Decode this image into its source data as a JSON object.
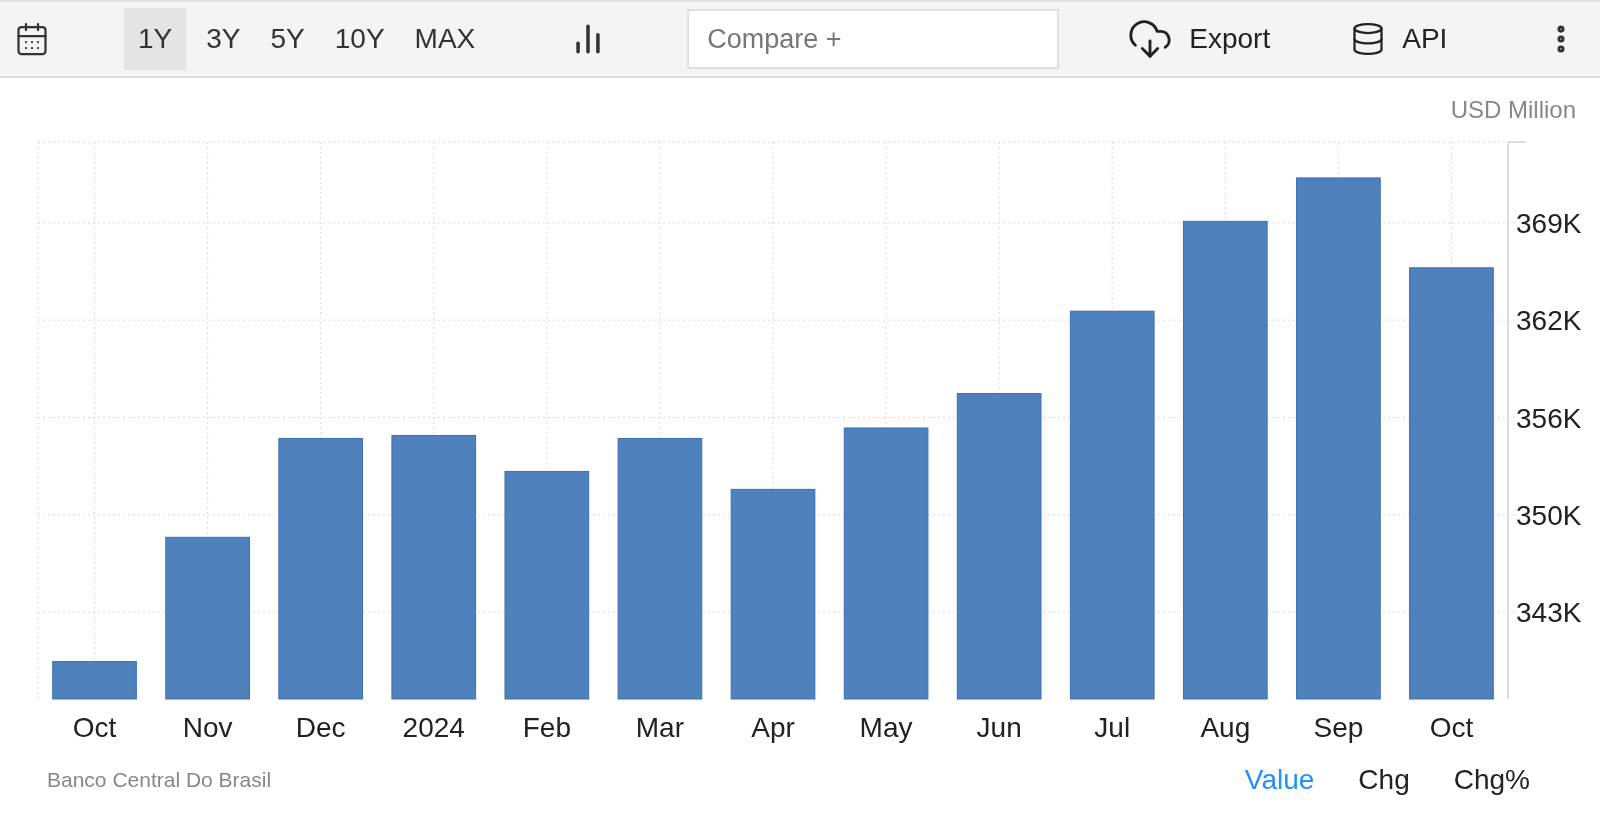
{
  "toolbar": {
    "ranges": [
      {
        "label": "1Y",
        "selected": true
      },
      {
        "label": "3Y",
        "selected": false
      },
      {
        "label": "5Y",
        "selected": false
      },
      {
        "label": "10Y",
        "selected": false
      },
      {
        "label": "MAX",
        "selected": false
      }
    ],
    "compare": {
      "placeholder": "Compare +"
    },
    "export": "Export",
    "api": "API"
  },
  "chart": {
    "unit": "USD Million",
    "chart_data": {
      "type": "bar",
      "categories": [
        "Oct",
        "Nov",
        "Dec",
        "2024",
        "Feb",
        "Mar",
        "Apr",
        "May",
        "Jun",
        "Jul",
        "Aug",
        "Sep",
        "Oct"
      ],
      "grid": true,
      "series": [
        {
          "color": "#4f81bd",
          "values": [
            339.7,
            348.0,
            354.6,
            354.8,
            352.4,
            354.6,
            351.2,
            355.3,
            357.6,
            363.1,
            369.1,
            372.0,
            366.0
          ]
        }
      ],
      "ylim": [
        337.2,
        374.4
      ],
      "yticks": [
        {
          "value": 343,
          "label": "343K"
        },
        {
          "value": 349.5,
          "label": "350K"
        },
        {
          "value": 356,
          "label": "356K"
        },
        {
          "value": 362.5,
          "label": "362K"
        },
        {
          "value": 369,
          "label": "369K"
        }
      ]
    }
  },
  "footer": {
    "source": "Banco Central Do Brasil",
    "views": [
      {
        "label": "Value",
        "selected": true
      },
      {
        "label": "Chg",
        "selected": false
      },
      {
        "label": "Chg%",
        "selected": false
      }
    ]
  }
}
